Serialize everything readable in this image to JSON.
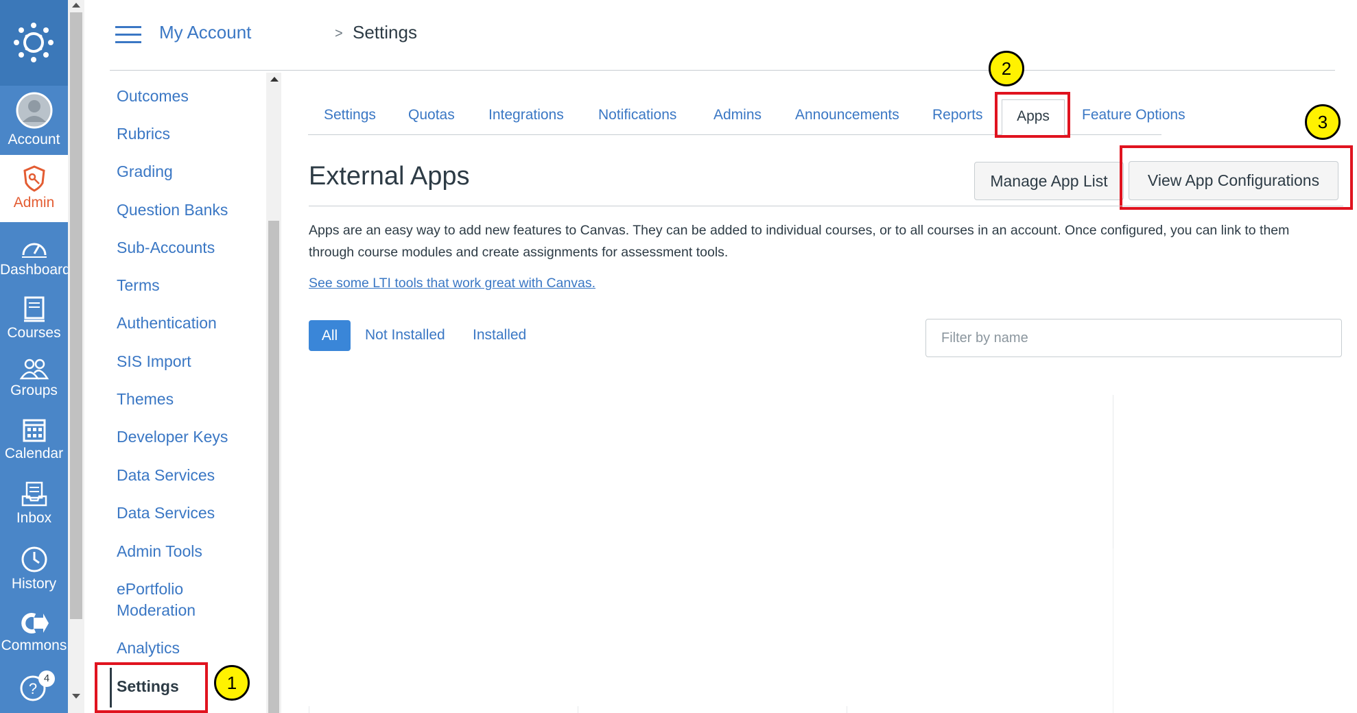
{
  "global_nav": {
    "items": [
      {
        "label": "Account",
        "icon": "avatar-icon"
      },
      {
        "label": "Admin",
        "icon": "admin-shield-icon"
      },
      {
        "label": "Dashboard",
        "icon": "dashboard-icon"
      },
      {
        "label": "Courses",
        "icon": "courses-icon"
      },
      {
        "label": "Groups",
        "icon": "groups-icon"
      },
      {
        "label": "Calendar",
        "icon": "calendar-icon"
      },
      {
        "label": "Inbox",
        "icon": "inbox-icon"
      },
      {
        "label": "History",
        "icon": "history-icon"
      },
      {
        "label": "Commons",
        "icon": "commons-icon"
      }
    ],
    "help_badge": "4",
    "colors": {
      "nav_bg": "#4a86c8",
      "admin_active": "#e35c32"
    }
  },
  "breadcrumb": {
    "root": "My Account",
    "current": "Settings"
  },
  "subnav": {
    "items": [
      "Outcomes",
      "Rubrics",
      "Grading",
      "Question Banks",
      "Sub-Accounts",
      "Terms",
      "Authentication",
      "SIS Import",
      "Themes",
      "Developer Keys",
      "Data Services",
      "Data Services",
      "Admin Tools",
      "ePortfolio",
      "Moderation",
      "Analytics"
    ],
    "active": "Settings"
  },
  "tabs": {
    "items": [
      "Settings",
      "Quotas",
      "Integrations",
      "Notifications",
      "Admins",
      "Announcements",
      "Reports",
      "Apps",
      "Feature Options"
    ],
    "active": "Apps"
  },
  "main": {
    "title": "External Apps",
    "manage_button": "Manage App List",
    "view_config_button": "View App Configurations",
    "description": "Apps are an easy way to add new features to Canvas. They can be added to individual courses, or to all courses in an account. Once configured, you can link to them through course modules and create assignments for assessment tools.",
    "lti_link": "See some LTI tools that work great with Canvas.",
    "filters": [
      "All",
      "Not Installed",
      "Installed"
    ],
    "filter_placeholder": "Filter by name"
  },
  "callouts": [
    "1",
    "2",
    "3"
  ],
  "colors": {
    "link": "#3a77c4",
    "highlight": "#e0131f",
    "callout": "#fff200",
    "primary_button": "#3a86d8"
  }
}
